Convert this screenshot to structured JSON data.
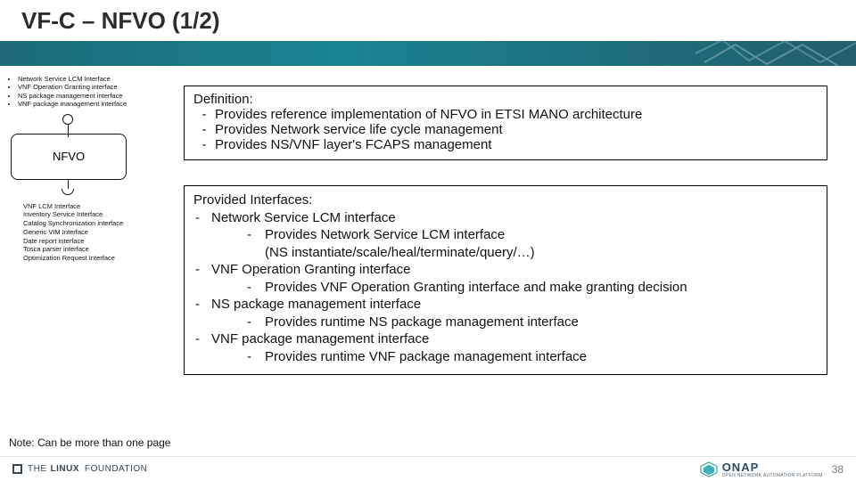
{
  "title": "VF-C – NFVO (1/2)",
  "top_interfaces": [
    "Network Service LCM Interface",
    "VNF Operation Granting interface",
    "NS package management interface",
    "VNF package management interface"
  ],
  "component_label": "NFVO",
  "bottom_interfaces": [
    "VNF LCM Interface",
    "Inventory Service Interface",
    "Catalog Synchronization interface",
    "Generic VIM Interface",
    "Date report interface",
    "Tosca parser interface",
    "Optimization Request Interface"
  ],
  "definition": {
    "heading": "Definition:",
    "items": [
      "Provides reference implementation of NFVO in ETSI MANO architecture",
      "Provides Network service life cycle management",
      "Provides NS/VNF layer's FCAPS management"
    ]
  },
  "provided": {
    "heading": "Provided Interfaces:",
    "items": [
      {
        "name": "Network Service LCM interface",
        "subs": [
          "Provides Network Service LCM interface",
          "(NS instantiate/scale/heal/terminate/query/…)"
        ]
      },
      {
        "name": "VNF Operation Granting interface",
        "subs": [
          "Provides VNF Operation Granting interface and make granting decision"
        ]
      },
      {
        "name": "NS package management interface",
        "subs": [
          "Provides runtime NS package management interface"
        ]
      },
      {
        "name": "VNF package management interface",
        "subs": [
          "Provides runtime VNF package management interface"
        ]
      }
    ]
  },
  "note": "Note: Can be more than one page",
  "footer": {
    "linux_thin": "THE",
    "linux_bold": "LINUX",
    "linux_tail": "FOUNDATION",
    "onap_title": "ONAP",
    "onap_sub": "OPEN NETWORK AUTOMATION PLATFORM",
    "page": "38"
  }
}
